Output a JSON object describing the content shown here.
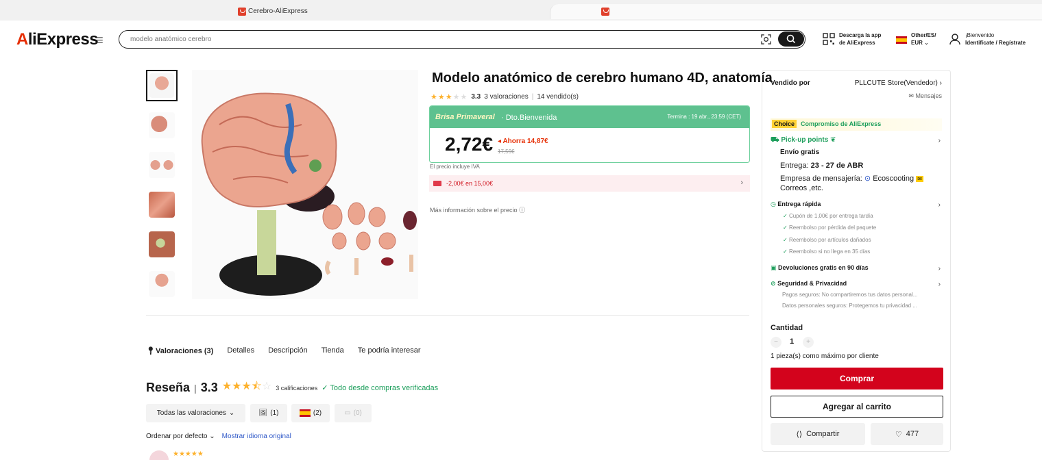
{
  "browser": {
    "tab_title": "Cerebro-AliExpress"
  },
  "header": {
    "logo": "AliExpress",
    "search_placeholder": "modelo anatómico cerebro",
    "app_line1": "Descarga la app",
    "app_line2": "de AliExpress",
    "locale_line1": "Other/ES/",
    "locale_line2": "EUR",
    "welcome_line1": "¡Bienvenido",
    "welcome_line2": "Identifícate / Regístrate"
  },
  "product": {
    "title": "Modelo anatómico de cerebro humano 4D, anatomía",
    "rating": "3.3",
    "reviews_text": "3 valoraciones",
    "sold_text": "14 vendido(s)",
    "promo_name": "Brisa Primaveral",
    "promo_discount": "· Dto.Bienvenida",
    "promo_ends": "Termina :  19 abr., 23:59 (CET)",
    "price": "2,72€",
    "save_text": "Ahorra 14,87€",
    "original_price": "17,59€",
    "vat_note": "El precio incluye IVA",
    "coupon_text": "-2,00€ en 15,00€",
    "more_info": "Más información sobre el precio"
  },
  "tabs": [
    "Valoraciones (3)",
    "Detalles",
    "Descripción",
    "Tienda",
    "Te podría interesar"
  ],
  "reviews": {
    "heading": "Reseña",
    "score": "3.3",
    "count_text": "3 calificaciones",
    "verified_text": "Todo desde compras verificadas",
    "filter_all": "Todas las valoraciones",
    "filter_photos": "(1)",
    "filter_es": "(2)",
    "filter_comments": "(0)",
    "sort_label": "Ordenar por defecto",
    "original_lang": "Mostrar idioma original"
  },
  "side_panel": {
    "sold_by_label": "Vendido por",
    "store_name": "PLLCUTE Store(Vendedor)",
    "messages": "Mensajes",
    "choice_badge": "Choice",
    "choice_text": "Compromiso de AliExpress",
    "pickup": "Pick-up points",
    "free_shipping": "Envío gratis",
    "delivery_label": "Entrega:",
    "delivery_dates": "23 - 27 de ABR",
    "courier_label": "Empresa de mensajería:",
    "courier_name": "Ecoscooting",
    "courier_more": "Correos ,etc.",
    "fast_delivery": "Entrega rápida",
    "fast_items": [
      "Cupón de 1,00€ por entrega tardía",
      "Reembolso por pérdida del paquete",
      "Reembolso por artículos dañados",
      "Reembolso si no llega en 35 días"
    ],
    "returns": "Devoluciones gratis en 90 días",
    "security": "Seguridad & Privacidad",
    "security_items": [
      "Pagos seguros: No compartiremos tus datos personal...",
      "Datos personales seguros: Protegemos tu privacidad ..."
    ],
    "quantity_label": "Cantidad",
    "quantity_value": "1",
    "quantity_note": "1 pieza(s) como máximo por cliente",
    "buy_label": "Comprar",
    "cart_label": "Agregar al carrito",
    "share_label": "Compartir",
    "wishlist_count": "477"
  },
  "colors": {
    "accent": "#e62e04",
    "buy": "#d3031c",
    "promo": "#5ec18f",
    "verified": "#1c9e5b",
    "star": "#fdb12c"
  }
}
